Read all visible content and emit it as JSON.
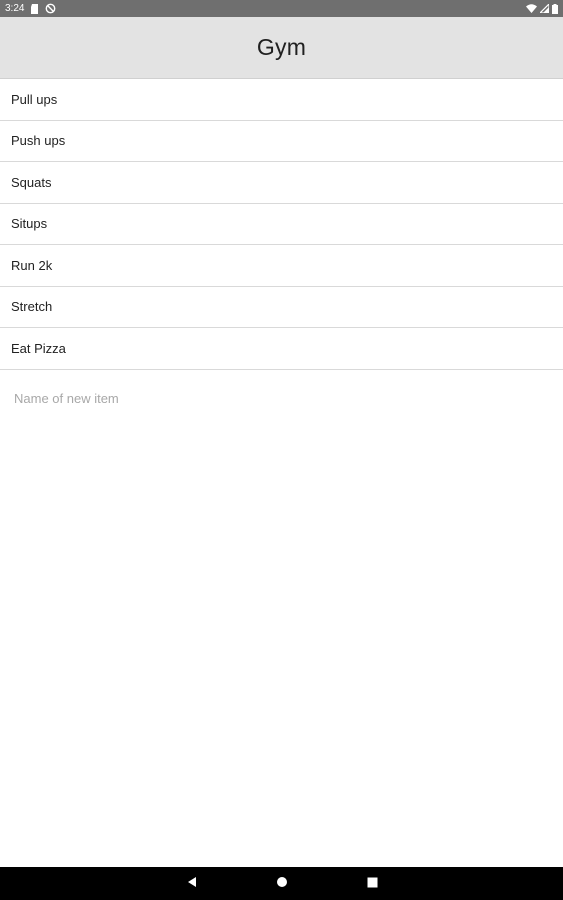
{
  "status_bar": {
    "time": "3:24",
    "left_icons": [
      "sd-card-icon",
      "no-sync-icon"
    ],
    "right_icons": [
      "wifi-icon",
      "signal-icon",
      "battery-icon"
    ]
  },
  "app_bar": {
    "title": "Gym"
  },
  "list": {
    "items": [
      {
        "label": "Pull ups"
      },
      {
        "label": "Push ups"
      },
      {
        "label": "Squats"
      },
      {
        "label": "Situps"
      },
      {
        "label": "Run 2k"
      },
      {
        "label": "Stretch"
      },
      {
        "label": "Eat Pizza"
      }
    ]
  },
  "new_item": {
    "value": "",
    "placeholder": "Name of new item"
  },
  "nav_bar": {
    "buttons": [
      "back-icon",
      "home-icon",
      "recents-icon"
    ]
  },
  "colors": {
    "status_bar": "#6f6f6f",
    "app_bar": "#e3e3e3",
    "divider": "#d9d9d9",
    "nav_bar": "#000000"
  }
}
